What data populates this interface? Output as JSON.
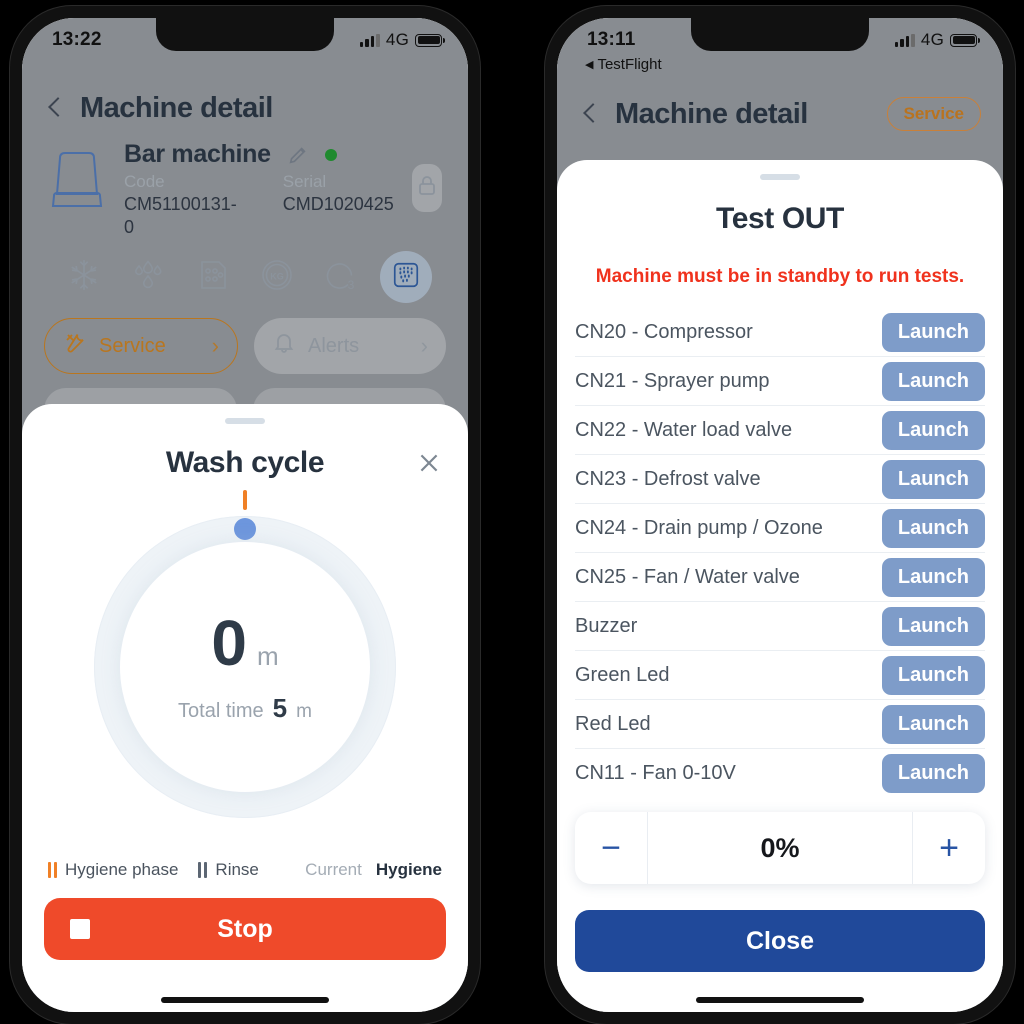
{
  "left_phone": {
    "status_bar": {
      "time": "13:22",
      "network": "4G"
    },
    "nav": {
      "title": "Machine detail",
      "back_icon": "chevron-left-icon"
    },
    "machine": {
      "name": "Bar machine",
      "code_label": "Code",
      "code_value": "CM51100131-0",
      "serial_label": "Serial",
      "serial_value": "CMD1020425",
      "edit_icon": "pencil-icon",
      "status_dot_color": "#1f8a2e",
      "lock_icon": "lock-icon"
    },
    "feature_tabs": [
      {
        "name": "snowflake-icon",
        "selected": false
      },
      {
        "name": "water-drops-icon",
        "selected": false
      },
      {
        "name": "ice-tray-icon",
        "selected": false
      },
      {
        "name": "kg-icon",
        "selected": false
      },
      {
        "name": "ozone-o3-icon",
        "selected": false
      },
      {
        "name": "wash-spray-icon",
        "selected": true
      }
    ],
    "actions": [
      {
        "label": "Service",
        "icon": "tools-icon",
        "style": "outline-orange"
      },
      {
        "label": "Alerts",
        "icon": "bell-icon",
        "style": "muted"
      }
    ],
    "sheet": {
      "title": "Wash cycle",
      "close_icon": "close-x-icon",
      "gauge": {
        "elapsed_value": "0",
        "elapsed_unit": "m",
        "total_label": "Total time",
        "total_value": "5",
        "total_unit": "m",
        "progress_percent": 0,
        "knob_color": "#6d96dd",
        "tick_color": "#f08026"
      },
      "legend": {
        "phase_1": "Hygiene phase",
        "phase_2": "Rinse",
        "current_label": "Current",
        "current_value": "Hygiene"
      },
      "primary_button": {
        "label": "Stop",
        "color": "#ef4a2a",
        "icon": "stop-square-icon"
      }
    }
  },
  "right_phone": {
    "status_bar": {
      "time": "13:11",
      "network": "4G",
      "back_app": "TestFlight"
    },
    "nav": {
      "title": "Machine detail",
      "back_icon": "chevron-left-icon",
      "badge": "Service"
    },
    "sheet": {
      "title": "Test OUT",
      "warning": "Machine must be in standby to run tests.",
      "launch_label": "Launch",
      "tests": [
        "CN20 - Compressor",
        "CN21 - Sprayer pump",
        "CN22 - Water load valve",
        "CN23 - Defrost valve",
        "CN24 - Drain pump / Ozone",
        "CN25 - Fan / Water valve",
        "Buzzer",
        "Green Led",
        "Red Led",
        "CN11 - Fan 0-10V"
      ],
      "stepper": {
        "decrement": "−",
        "value": "0%",
        "increment": "+"
      },
      "close_button": {
        "label": "Close",
        "color": "#20499a"
      }
    }
  }
}
